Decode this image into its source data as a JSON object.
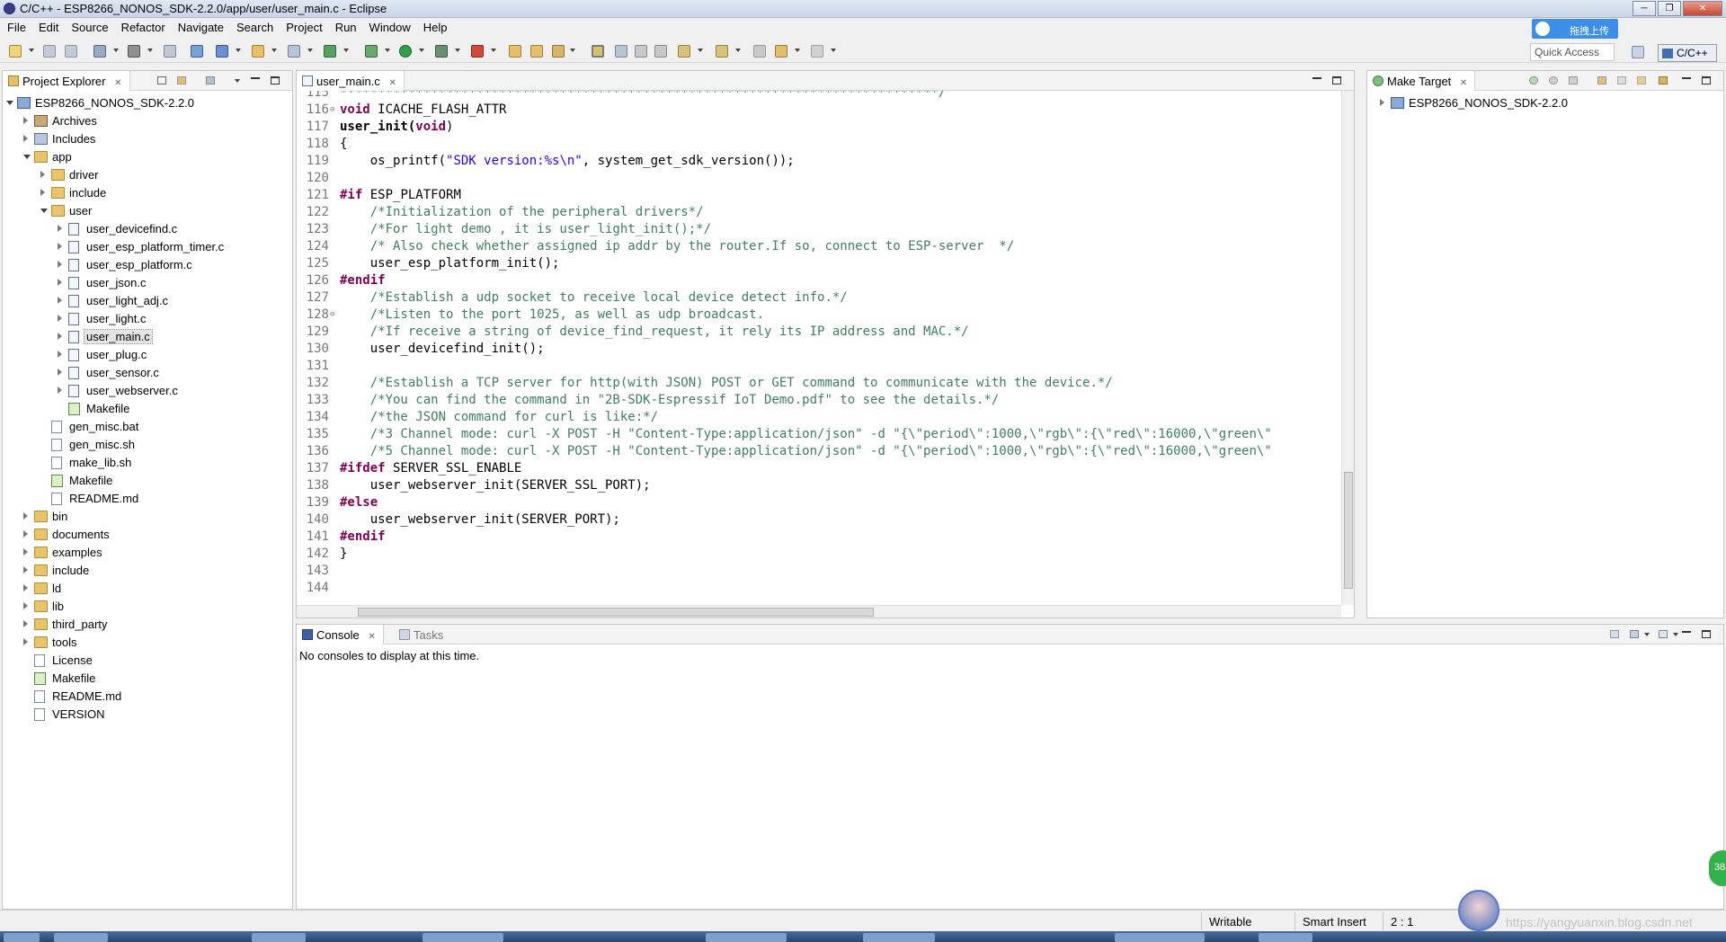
{
  "window": {
    "title": "C/C++ - ESP8266_NONOS_SDK-2.2.0/app/user/user_main.c - Eclipse"
  },
  "menu": [
    "File",
    "Edit",
    "Source",
    "Refactor",
    "Navigate",
    "Search",
    "Project",
    "Run",
    "Window",
    "Help"
  ],
  "overlay": {
    "upload_label": "拖拽上传"
  },
  "quick_access": "Quick Access",
  "perspective": "C/C++",
  "project_explorer": {
    "tab_label": "Project Explorer",
    "tree": [
      {
        "label": "ESP8266_NONOS_SDK-2.2.0",
        "depth": 0,
        "icon": "project",
        "arrow": "open"
      },
      {
        "label": "Archives",
        "depth": 1,
        "icon": "archive",
        "arrow": "closed"
      },
      {
        "label": "Includes",
        "depth": 1,
        "icon": "includes",
        "arrow": "closed"
      },
      {
        "label": "app",
        "depth": 1,
        "icon": "folder",
        "arrow": "open"
      },
      {
        "label": "driver",
        "depth": 2,
        "icon": "folder",
        "arrow": "closed"
      },
      {
        "label": "include",
        "depth": 2,
        "icon": "folder",
        "arrow": "closed"
      },
      {
        "label": "user",
        "depth": 2,
        "icon": "folder",
        "arrow": "open"
      },
      {
        "label": "user_devicefind.c",
        "depth": 3,
        "icon": "cfile",
        "arrow": "closed"
      },
      {
        "label": "user_esp_platform_timer.c",
        "depth": 3,
        "icon": "cfile",
        "arrow": "closed"
      },
      {
        "label": "user_esp_platform.c",
        "depth": 3,
        "icon": "cfile",
        "arrow": "closed"
      },
      {
        "label": "user_json.c",
        "depth": 3,
        "icon": "cfile",
        "arrow": "closed"
      },
      {
        "label": "user_light_adj.c",
        "depth": 3,
        "icon": "cfile",
        "arrow": "closed"
      },
      {
        "label": "user_light.c",
        "depth": 3,
        "icon": "cfile",
        "arrow": "closed"
      },
      {
        "label": "user_main.c",
        "depth": 3,
        "icon": "cfile",
        "arrow": "closed",
        "selected": true
      },
      {
        "label": "user_plug.c",
        "depth": 3,
        "icon": "cfile",
        "arrow": "closed"
      },
      {
        "label": "user_sensor.c",
        "depth": 3,
        "icon": "cfile",
        "arrow": "closed"
      },
      {
        "label": "user_webserver.c",
        "depth": 3,
        "icon": "cfile",
        "arrow": "closed"
      },
      {
        "label": "Makefile",
        "depth": 3,
        "icon": "make",
        "arrow": "none"
      },
      {
        "label": "gen_misc.bat",
        "depth": 2,
        "icon": "file",
        "arrow": "none"
      },
      {
        "label": "gen_misc.sh",
        "depth": 2,
        "icon": "file",
        "arrow": "none"
      },
      {
        "label": "make_lib.sh",
        "depth": 2,
        "icon": "file",
        "arrow": "none"
      },
      {
        "label": "Makefile",
        "depth": 2,
        "icon": "make",
        "arrow": "none"
      },
      {
        "label": "README.md",
        "depth": 2,
        "icon": "file",
        "arrow": "none"
      },
      {
        "label": "bin",
        "depth": 1,
        "icon": "folder",
        "arrow": "closed"
      },
      {
        "label": "documents",
        "depth": 1,
        "icon": "folder",
        "arrow": "closed"
      },
      {
        "label": "examples",
        "depth": 1,
        "icon": "folder",
        "arrow": "closed"
      },
      {
        "label": "include",
        "depth": 1,
        "icon": "folder",
        "arrow": "closed"
      },
      {
        "label": "ld",
        "depth": 1,
        "icon": "folder",
        "arrow": "closed"
      },
      {
        "label": "lib",
        "depth": 1,
        "icon": "folder",
        "arrow": "closed"
      },
      {
        "label": "third_party",
        "depth": 1,
        "icon": "folder",
        "arrow": "closed"
      },
      {
        "label": "tools",
        "depth": 1,
        "icon": "folder",
        "arrow": "closed"
      },
      {
        "label": "License",
        "depth": 1,
        "icon": "file",
        "arrow": "none"
      },
      {
        "label": "Makefile",
        "depth": 1,
        "icon": "make",
        "arrow": "none"
      },
      {
        "label": "README.md",
        "depth": 1,
        "icon": "file",
        "arrow": "none"
      },
      {
        "label": "VERSION",
        "depth": 1,
        "icon": "file",
        "arrow": "none"
      }
    ]
  },
  "editor": {
    "tab_label": "user_main.c",
    "lines": [
      {
        "n": "115",
        "text": "*******************************************************************************/",
        "style": "cm"
      },
      {
        "n": "116",
        "fold": true,
        "parts": [
          {
            "t": "void",
            "s": "kw"
          },
          {
            "t": " ICACHE_FLASH_ATTR"
          }
        ]
      },
      {
        "n": "117",
        "parts": [
          {
            "t": "user_init(",
            "s": "b"
          },
          {
            "t": "void",
            "s": "kw"
          },
          {
            "t": ")"
          }
        ]
      },
      {
        "n": "118",
        "parts": [
          {
            "t": "{"
          }
        ]
      },
      {
        "n": "119",
        "parts": [
          {
            "t": "    os_printf("
          },
          {
            "t": "\"SDK version:%s\\n\"",
            "s": "st"
          },
          {
            "t": ", system_get_sdk_version());"
          }
        ]
      },
      {
        "n": "120",
        "parts": [
          {
            "t": ""
          }
        ]
      },
      {
        "n": "121",
        "parts": [
          {
            "t": "#if",
            "s": "pp"
          },
          {
            "t": " ESP_PLATFORM"
          }
        ]
      },
      {
        "n": "122",
        "parts": [
          {
            "t": "    /*Initialization of the peripheral drivers*/",
            "s": "cm"
          }
        ]
      },
      {
        "n": "123",
        "parts": [
          {
            "t": "    /*For light demo , it is user_light_init();*/",
            "s": "cm"
          }
        ]
      },
      {
        "n": "124",
        "parts": [
          {
            "t": "    /* Also check whether assigned ip addr by the router.If so, connect to ESP-server  */",
            "s": "cm"
          }
        ]
      },
      {
        "n": "125",
        "parts": [
          {
            "t": "    user_esp_platform_init();"
          }
        ]
      },
      {
        "n": "126",
        "parts": [
          {
            "t": "#endif",
            "s": "pp"
          }
        ]
      },
      {
        "n": "127",
        "parts": [
          {
            "t": "    /*Establish a udp socket to receive local device detect info.*/",
            "s": "cm"
          }
        ]
      },
      {
        "n": "128",
        "fold": true,
        "parts": [
          {
            "t": "    /*Listen to the port 1025, as well as udp broadcast.",
            "s": "cm"
          }
        ]
      },
      {
        "n": "129",
        "parts": [
          {
            "t": "    /*If receive a string of device_find_request, it rely its IP address and MAC.*/",
            "s": "cm"
          }
        ]
      },
      {
        "n": "130",
        "parts": [
          {
            "t": "    user_devicefind_init();"
          }
        ]
      },
      {
        "n": "131",
        "parts": [
          {
            "t": ""
          }
        ]
      },
      {
        "n": "132",
        "parts": [
          {
            "t": "    /*Establish a TCP server for http(with JSON) POST or GET command to communicate with the device.*/",
            "s": "cm"
          }
        ]
      },
      {
        "n": "133",
        "parts": [
          {
            "t": "    /*You can find the command in \"2B-SDK-Espressif IoT Demo.pdf\" to see the details.*/",
            "s": "cm"
          }
        ]
      },
      {
        "n": "134",
        "parts": [
          {
            "t": "    /*the JSON command for curl is like:*/",
            "s": "cm"
          }
        ]
      },
      {
        "n": "135",
        "parts": [
          {
            "t": "    /*3 Channel mode: curl -X POST -H \"Content-Type:application/json\" -d \"{\\\"period\\\":1000,\\\"rgb\\\":{\\\"red\\\":16000,\\\"green\\\"",
            "s": "cm"
          }
        ]
      },
      {
        "n": "136",
        "parts": [
          {
            "t": "    /*5 Channel mode: curl -X POST -H \"Content-Type:application/json\" -d \"{\\\"period\\\":1000,\\\"rgb\\\":{\\\"red\\\":16000,\\\"green\\\"",
            "s": "cm"
          }
        ]
      },
      {
        "n": "137",
        "hl": true,
        "parts": [
          {
            "t": "#ifdef",
            "s": "pp"
          },
          {
            "t": " SERVER_SSL_ENABLE"
          }
        ]
      },
      {
        "n": "138",
        "hl": true,
        "parts": [
          {
            "t": "    user_webserver_init(SERVER_SSL_PORT);"
          }
        ]
      },
      {
        "n": "139",
        "parts": [
          {
            "t": "#else",
            "s": "pp"
          }
        ]
      },
      {
        "n": "140",
        "parts": [
          {
            "t": "    user_webserver_init(SERVER_PORT);"
          }
        ]
      },
      {
        "n": "141",
        "parts": [
          {
            "t": "#endif",
            "s": "pp"
          }
        ]
      },
      {
        "n": "142",
        "parts": [
          {
            "t": "}"
          }
        ]
      },
      {
        "n": "143",
        "parts": [
          {
            "t": ""
          }
        ]
      },
      {
        "n": "144",
        "parts": [
          {
            "t": ""
          }
        ]
      }
    ]
  },
  "make_target": {
    "tab_label": "Make Target",
    "tree_root": "ESP8266_NONOS_SDK-2.2.0"
  },
  "console": {
    "tab_label": "Console",
    "tasks_label": "Tasks",
    "message": "No consoles to display at this time."
  },
  "status": {
    "writable": "Writable",
    "insert_mode": "Smart Insert",
    "position": "2 : 1"
  },
  "watermark": "https://yangyuanxin.blog.csdn.net",
  "badge": "38",
  "colors": {
    "keyword": "#7f0055",
    "comment": "#3f7f5f",
    "string": "#2a00ff",
    "line_highlight": "#e8e8e8"
  }
}
